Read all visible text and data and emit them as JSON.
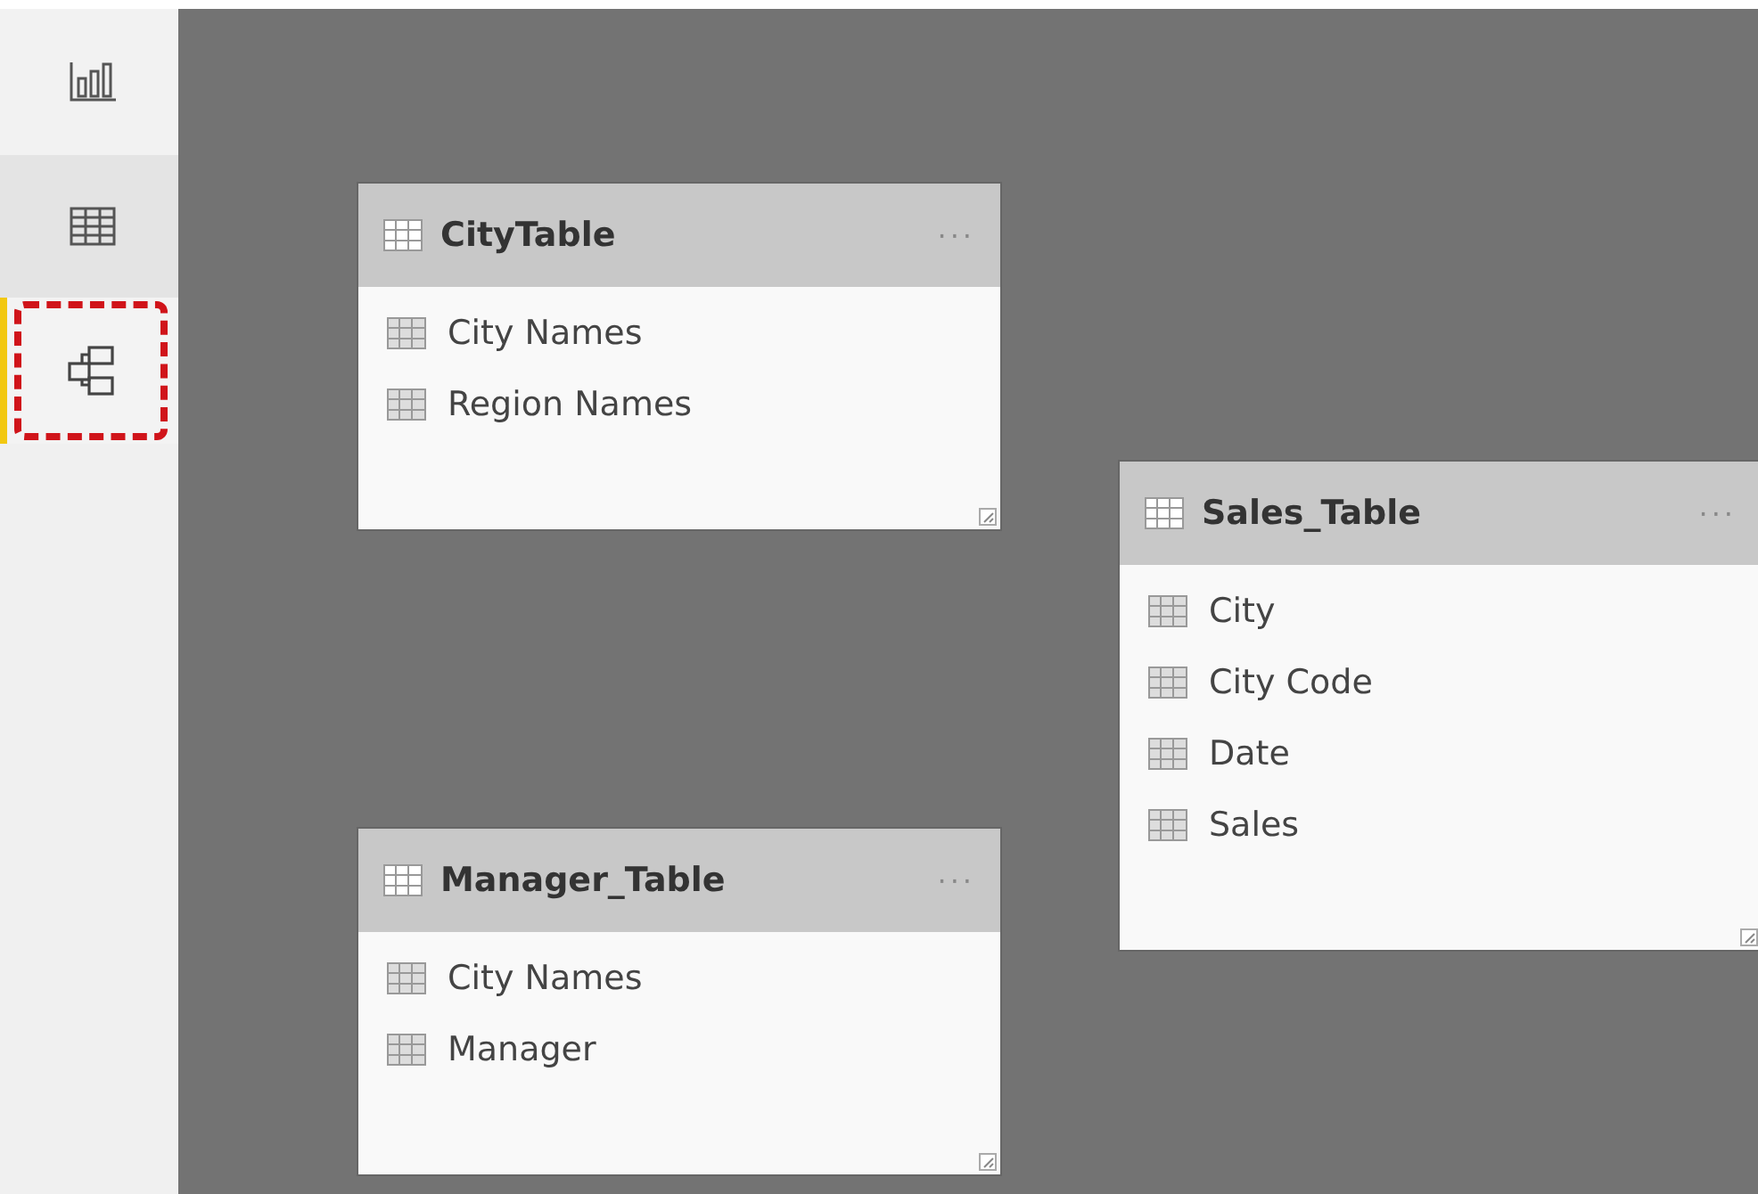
{
  "nav": [
    {
      "kind": "report",
      "selected": false,
      "highlighted": false
    },
    {
      "kind": "data",
      "selected": false,
      "highlighted": false
    },
    {
      "kind": "model",
      "selected": true,
      "highlighted": true
    }
  ],
  "tables": [
    {
      "name": "CityTable",
      "more": "···",
      "fields": [
        "City Names",
        "Region Names"
      ]
    },
    {
      "name": "Sales_Table",
      "more": "···",
      "fields": [
        "City",
        "City Code",
        "Date",
        "Sales"
      ]
    },
    {
      "name": "Manager_Table",
      "more": "···",
      "fields": [
        "City Names",
        "Manager"
      ]
    }
  ]
}
